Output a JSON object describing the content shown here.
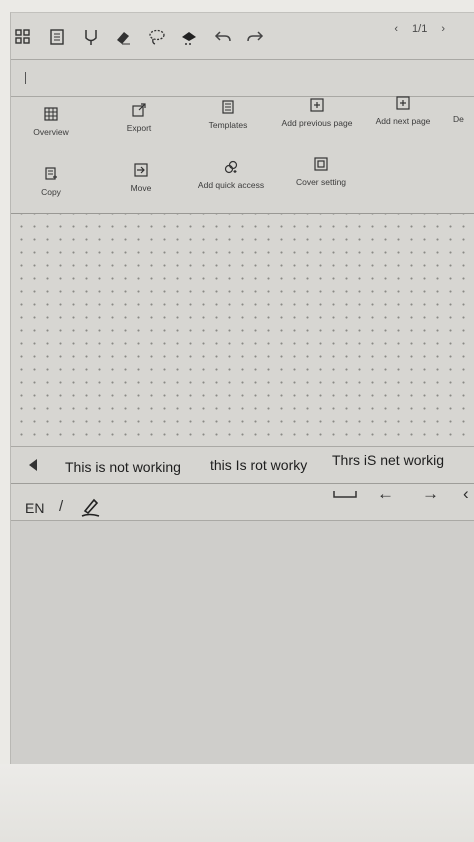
{
  "toolbar": {
    "icons": [
      "grid-icon",
      "document-icon",
      "pen-icon",
      "eraser-icon",
      "lasso-icon",
      "ink-icon",
      "undo-icon",
      "redo-icon"
    ],
    "page_prev": "‹",
    "page_indicator": "1/1",
    "page_next": "›"
  },
  "menu": {
    "items": [
      {
        "label": "Overview",
        "icon": "overview-icon"
      },
      {
        "label": "Export",
        "icon": "export-icon"
      },
      {
        "label": "Templates",
        "icon": "templates-icon"
      },
      {
        "label": "Add previous page",
        "icon": "add-previous-page-icon"
      },
      {
        "label": "Add next page",
        "icon": "add-next-page-icon"
      },
      {
        "label": "De",
        "icon": "delete-icon"
      },
      {
        "label": "Copy",
        "icon": "copy-icon"
      },
      {
        "label": "Move",
        "icon": "move-icon"
      },
      {
        "label": "Add quick access",
        "icon": "add-quick-access-icon"
      },
      {
        "label": "Cover setting",
        "icon": "cover-setting-icon"
      }
    ]
  },
  "suggestions": [
    "This is not working",
    "this Is rot worky",
    "Thrs iS net workig"
  ],
  "keyboard": {
    "language": "EN",
    "separator": "/",
    "arrow_left": "←",
    "arrow_right": "→",
    "arrow_more": "‹"
  }
}
